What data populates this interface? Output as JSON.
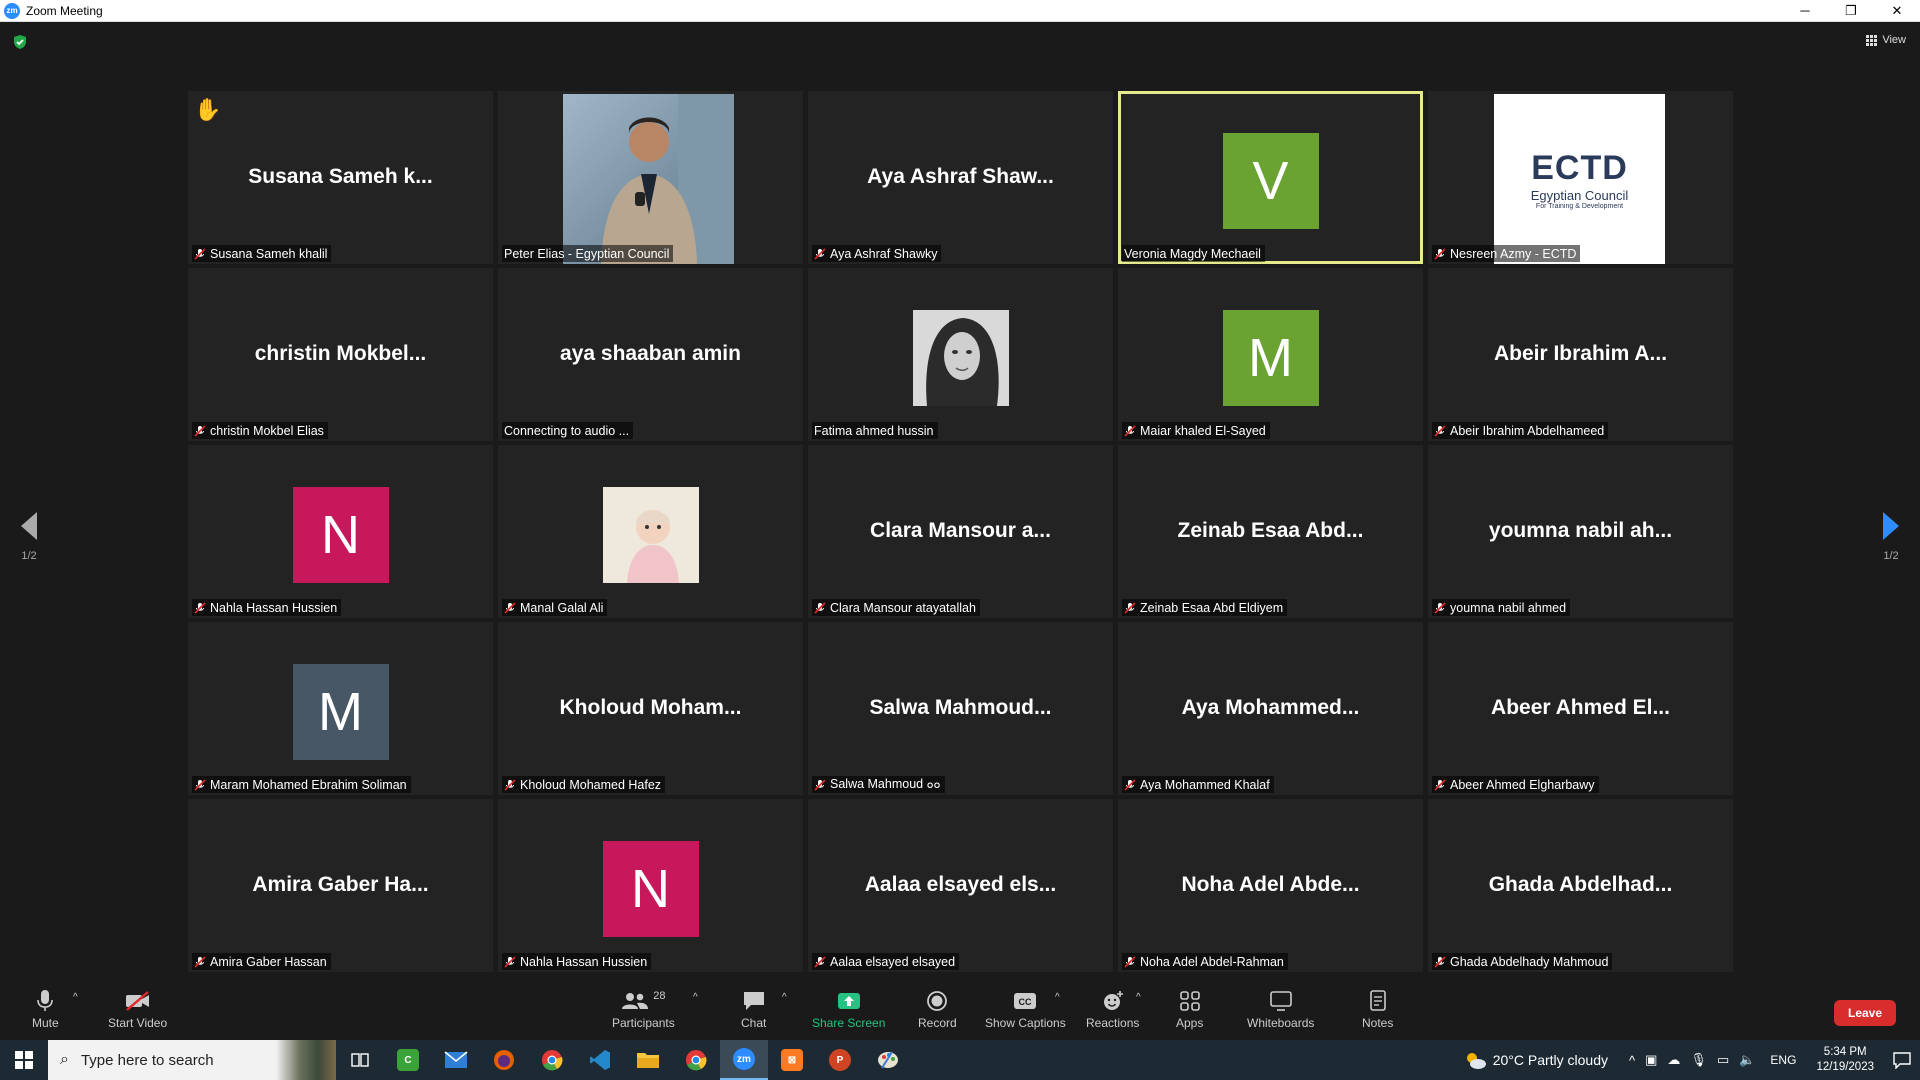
{
  "window": {
    "title": "Zoom Meeting",
    "app_logo": "zm",
    "minimize": "─",
    "restore": "❐",
    "close": "✕"
  },
  "header": {
    "view_label": "View"
  },
  "paging": {
    "left_page": "1/2",
    "right_page": "1/2"
  },
  "colors": {
    "active_border": "#e5ea8a",
    "green_avatar": "#6aa332",
    "pink_avatar": "#c8185c",
    "slate_avatar": "#475766",
    "leave": "#d92d2d",
    "share_green": "#26c281"
  },
  "tiles": [
    {
      "big_name": "Susana Sameh k...",
      "label": "Susana Sameh khalil",
      "muted": true,
      "raised_hand": true
    },
    {
      "label": "Peter Elias - Egyptian Council",
      "muted": false,
      "kind": "video"
    },
    {
      "big_name": "Aya Ashraf Shaw...",
      "label": "Aya Ashraf Shawky",
      "muted": true
    },
    {
      "avatar_letter": "V",
      "label": "Veronia Magdy Mechaeil",
      "muted": false,
      "active": true,
      "avatar_color": "green"
    },
    {
      "label": "Nesreen Azmy - ECTD",
      "muted": true,
      "kind": "logo",
      "logo_main": "ECTD",
      "logo_sub": "Egyptian Council",
      "logo_sub2": "For Training & Development"
    },
    {
      "big_name": "christin  Mokbel...",
      "label": "christin Mokbel Elias",
      "muted": true
    },
    {
      "big_name": "aya shaaban amin",
      "label": "Connecting to audio ...",
      "muted": false
    },
    {
      "label": "Fatima ahmed hussin",
      "muted": false,
      "kind": "photo-portrait"
    },
    {
      "avatar_letter": "M",
      "label": "Maiar khaled El-Sayed",
      "muted": true,
      "avatar_color": "green"
    },
    {
      "big_name": "Abeir Ibrahim A...",
      "label": "Abeir Ibrahim Abdelhameed",
      "muted": true
    },
    {
      "avatar_letter": "N",
      "label": "Nahla Hassan Hussien",
      "muted": true,
      "avatar_color": "pink"
    },
    {
      "label": "Manal Galal Ali",
      "muted": true,
      "kind": "photo-baby"
    },
    {
      "big_name": "Clara Mansour a...",
      "label": "Clara Mansour atayatallah",
      "muted": true
    },
    {
      "big_name": "Zeinab Esaa Abd...",
      "label": "Zeinab Esaa Abd Eldiyem",
      "muted": true
    },
    {
      "big_name": "youmna nabil ah...",
      "label": "youmna nabil ahmed",
      "muted": true
    },
    {
      "avatar_letter": "M",
      "label": "Maram Mohamed Ebrahim Soliman",
      "muted": true,
      "avatar_color": "slate"
    },
    {
      "big_name": "Kholoud  Moham...",
      "label": "Kholoud Mohamed Hafez",
      "muted": true
    },
    {
      "big_name": "Salwa  Mahmoud...",
      "label": "Salwa Mahmoud ܘܘ",
      "muted": true
    },
    {
      "big_name": "Aya  Mohammed...",
      "label": "Aya Mohammed Khalaf",
      "muted": true
    },
    {
      "big_name": "Abeer Ahmed El...",
      "label": "Abeer Ahmed Elgharbawy",
      "muted": true
    },
    {
      "big_name": "Amira Gaber Ha...",
      "label": "Amira Gaber Hassan",
      "muted": true
    },
    {
      "avatar_letter": "N",
      "label": "Nahla Hassan Hussien",
      "muted": true,
      "avatar_color": "pink"
    },
    {
      "big_name": "Aalaa elsayed els...",
      "label": "Aalaa elsayed elsayed",
      "muted": true
    },
    {
      "big_name": "Noha Adel Abde...",
      "label": "Noha Adel Abdel-Rahman",
      "muted": true
    },
    {
      "big_name": "Ghada Abdelhad...",
      "label": "Ghada Abdelhady Mahmoud",
      "muted": true
    }
  ],
  "toolbar": {
    "mute": "Mute",
    "start_video": "Start Video",
    "participants": "Participants",
    "participants_count": "28",
    "chat": "Chat",
    "share_screen": "Share Screen",
    "record": "Record",
    "show_captions": "Show Captions",
    "reactions": "Reactions",
    "apps": "Apps",
    "whiteboards": "Whiteboards",
    "notes": "Notes",
    "leave": "Leave"
  },
  "taskbar": {
    "search_placeholder": "Type here to search",
    "weather": "20°C  Partly cloudy",
    "language": "ENG",
    "time": "5:34 PM",
    "date": "12/19/2023"
  }
}
